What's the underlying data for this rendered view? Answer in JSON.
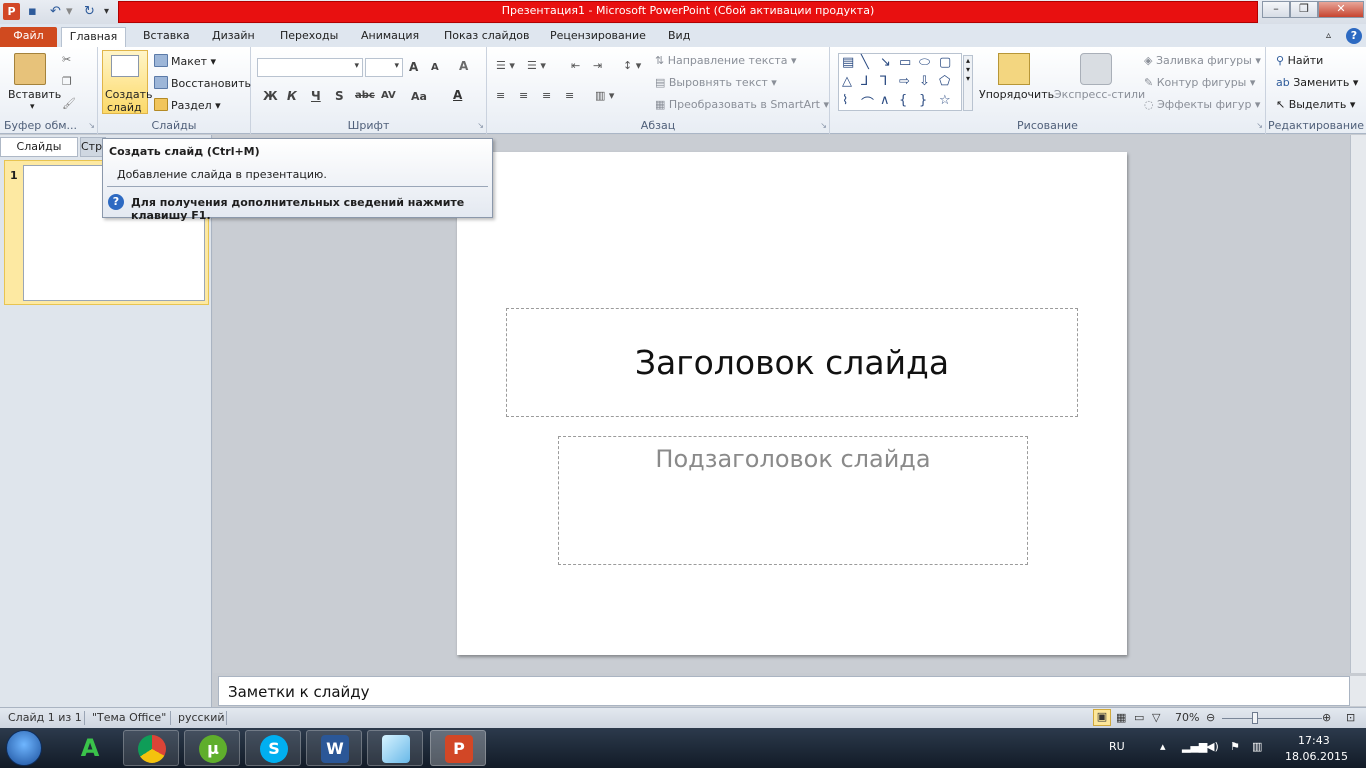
{
  "window": {
    "title": "Презентация1  -  Microsoft PowerPoint (Сбой активации продукта)",
    "app_icon": "P",
    "accent_color": "#e81010"
  },
  "tabs": [
    {
      "label": "Файл"
    },
    {
      "label": "Главная"
    },
    {
      "label": "Вставка"
    },
    {
      "label": "Дизайн"
    },
    {
      "label": "Переходы"
    },
    {
      "label": "Анимация"
    },
    {
      "label": "Показ слайдов"
    },
    {
      "label": "Рецензирование"
    },
    {
      "label": "Вид"
    }
  ],
  "ribbon": {
    "clipboard": {
      "paste": "Вставить",
      "label": "Буфер обм..."
    },
    "slides": {
      "new_slide_line1": "Создать",
      "new_slide_line2": "слайд",
      "layout": "Макет",
      "reset": "Восстановить",
      "section": "Раздел",
      "label": "Слайды"
    },
    "font": {
      "bold": "Ж",
      "italic": "К",
      "underline": "Ч",
      "shadow": "S",
      "strike": "abc",
      "spacing": "AV",
      "case": "Aa",
      "grow": "A",
      "shrink": "A",
      "clear": "A",
      "label": "Шрифт"
    },
    "paragraph": {
      "text_direction": "Направление текста",
      "align_text": "Выровнять текст",
      "smartart": "Преобразовать в SmartArt",
      "label": "Абзац"
    },
    "drawing": {
      "arrange": "Упорядочить",
      "quick_styles": "Экспресс-стили",
      "shape_fill": "Заливка фигуры",
      "shape_outline": "Контур фигуры",
      "shape_effects": "Эффекты фигур",
      "label": "Рисование"
    },
    "editing": {
      "find": "Найти",
      "replace": "Заменить",
      "select": "Выделить",
      "label": "Редактирование"
    }
  },
  "left_pane": {
    "tab_slides": "Слайды",
    "tab_outline": "Структура",
    "thumb_number": "1"
  },
  "tooltip": {
    "title": "Создать слайд (Ctrl+M)",
    "description": "Добавление слайда в презентацию.",
    "help": "Для получения дополнительных сведений нажмите клавишу F1."
  },
  "slide": {
    "title_placeholder": "Заголовок слайда",
    "subtitle_placeholder": "Подзаголовок слайда"
  },
  "notes": {
    "placeholder": "Заметки к слайду"
  },
  "status_bar": {
    "slide_info": "Слайд 1 из 1",
    "theme": "\"Тема Office\"",
    "language": "русский",
    "zoom": "70%"
  },
  "taskbar": {
    "language": "RU",
    "time": "17:43",
    "date": "18.06.2015"
  }
}
